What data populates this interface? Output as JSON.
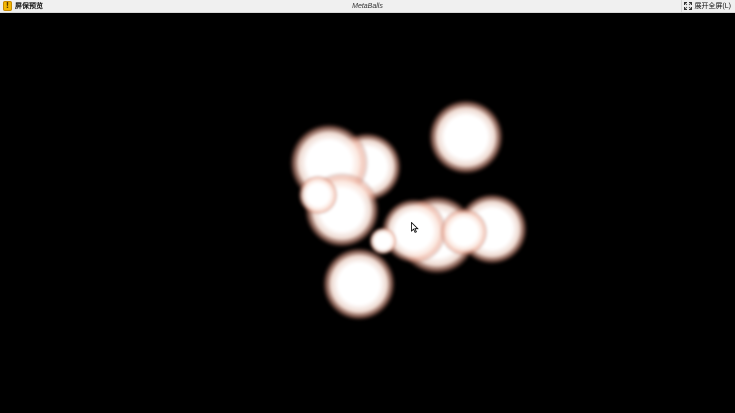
{
  "app": {
    "name": "屏保预览",
    "badge_glyph": "!"
  },
  "window": {
    "title": "MetaBalls"
  },
  "toolbar": {
    "fullscreen_label": "展开全屏(L)"
  },
  "scene": {
    "background": "#000000",
    "glow_color": "#e9a48f",
    "core_color": "#ffffff",
    "icons": [
      "maximize-icon",
      "mouse-cursor-icon"
    ]
  }
}
